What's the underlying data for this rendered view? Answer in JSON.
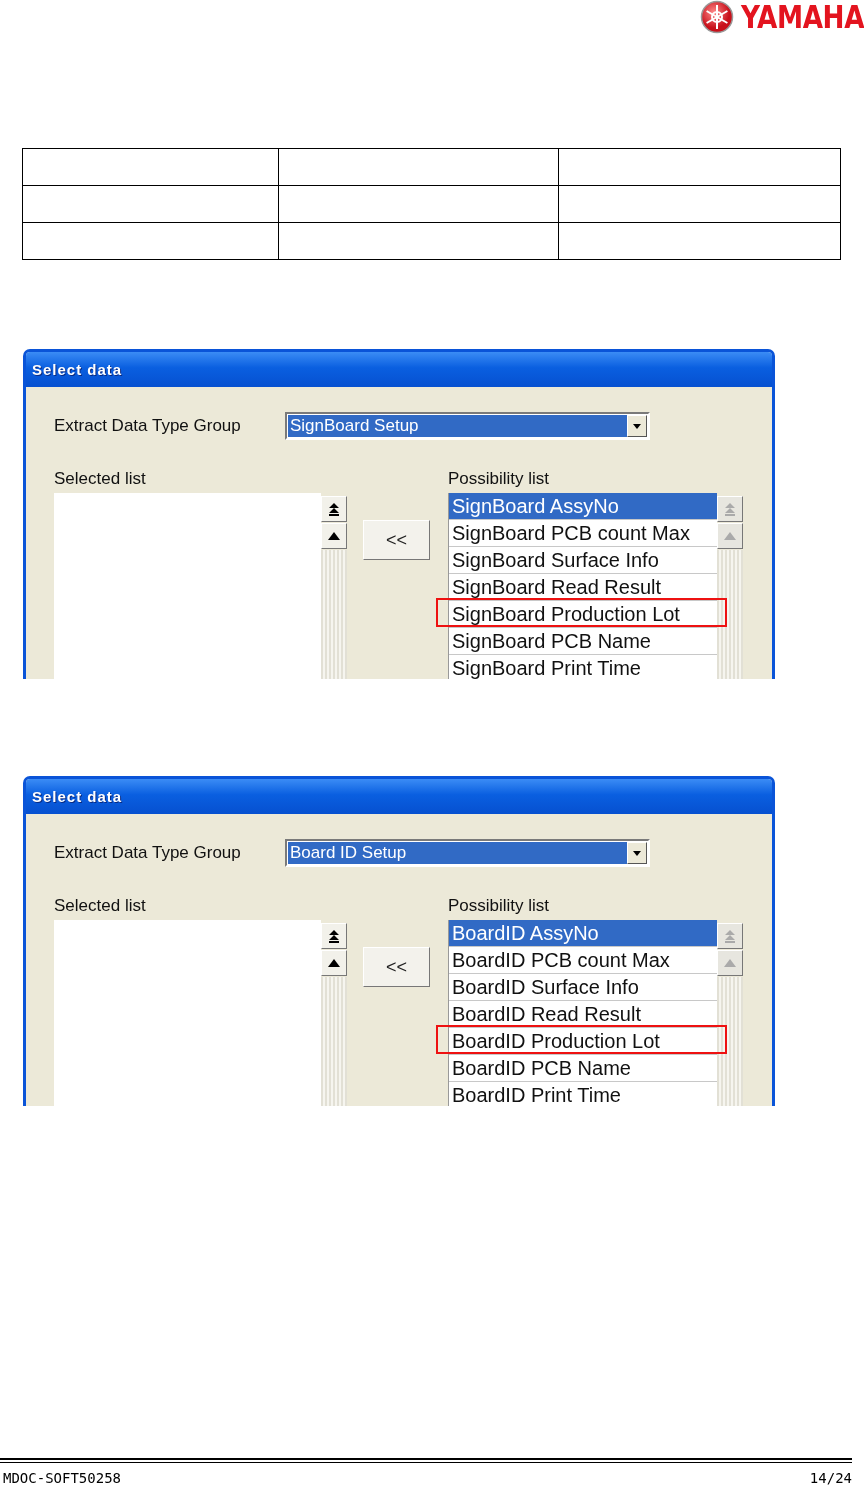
{
  "header": {
    "logo_text": "YAMAHA"
  },
  "dialogs": [
    {
      "title": "Select data",
      "group_label": "Extract Data Type Group",
      "group_value": "SignBoard Setup",
      "selected_list": {
        "label": "Selected list",
        "scroll_disabled": false
      },
      "move_button": "<<",
      "possibility_list": {
        "label": "Possibility list",
        "scroll_disabled": true,
        "items": [
          {
            "text": "SignBoard AssyNo",
            "selected": true,
            "highlighted": false
          },
          {
            "text": "SignBoard PCB count Max",
            "selected": false,
            "highlighted": false
          },
          {
            "text": "SignBoard Surface Info",
            "selected": false,
            "highlighted": false
          },
          {
            "text": "SignBoard Read Result",
            "selected": false,
            "highlighted": false
          },
          {
            "text": "SignBoard Production Lot",
            "selected": false,
            "highlighted": true
          },
          {
            "text": "SignBoard PCB Name",
            "selected": false,
            "highlighted": false
          },
          {
            "text": "SignBoard Print Time",
            "selected": false,
            "highlighted": false
          }
        ]
      }
    },
    {
      "title": "Select data",
      "group_label": "Extract Data Type Group",
      "group_value": "Board ID Setup",
      "selected_list": {
        "label": "Selected list",
        "scroll_disabled": false
      },
      "move_button": "<<",
      "possibility_list": {
        "label": "Possibility list",
        "scroll_disabled": true,
        "items": [
          {
            "text": "BoardID AssyNo",
            "selected": true,
            "highlighted": false
          },
          {
            "text": "BoardID PCB count Max",
            "selected": false,
            "highlighted": false
          },
          {
            "text": "BoardID Surface Info",
            "selected": false,
            "highlighted": false
          },
          {
            "text": "BoardID Read Result",
            "selected": false,
            "highlighted": false
          },
          {
            "text": "BoardID Production Lot",
            "selected": false,
            "highlighted": true
          },
          {
            "text": "BoardID PCB Name",
            "selected": false,
            "highlighted": false
          },
          {
            "text": "BoardID Print Time",
            "selected": false,
            "highlighted": false
          }
        ]
      }
    }
  ],
  "footer": {
    "doc_id": "MDOC-SOFT50258",
    "page": "14/24"
  }
}
